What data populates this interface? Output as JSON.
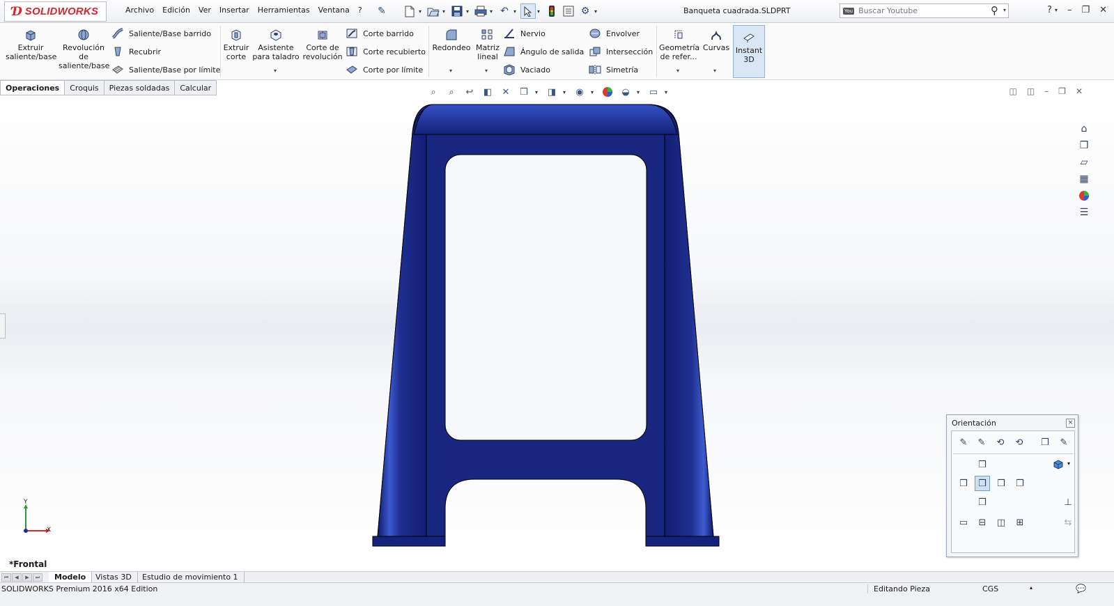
{
  "app": {
    "brand": "SOLIDWORKS",
    "document_title": "Banqueta cuadrada.SLDPRT"
  },
  "menu": [
    "Archivo",
    "Edición",
    "Ver",
    "Insertar",
    "Herramientas",
    "Ventana",
    "?"
  ],
  "search": {
    "placeholder": "Buscar Youtube",
    "badge": "You"
  },
  "ribbon": {
    "extruir_saliente": "Extruir\nsaliente/base",
    "revolucion_saliente": "Revolución\nde\nsaliente/base",
    "saliente_barrido": "Saliente/Base barrido",
    "recubrir": "Recubrir",
    "saliente_limite": "Saliente/Base por límite",
    "extruir_corte": "Extruir\ncorte",
    "asistente_taladro": "Asistente\npara taladro",
    "corte_revolucion": "Corte de\nrevolución",
    "corte_barrido": "Corte barrido",
    "corte_recubierto": "Corte recubierto",
    "corte_limite": "Corte por límite",
    "redondeo": "Redondeo",
    "matriz_lineal": "Matriz\nlineal",
    "nervio": "Nervio",
    "angulo_salida": "Ángulo de salida",
    "vaciado": "Vaciado",
    "envolver": "Envolver",
    "interseccion": "Intersección",
    "simetria": "Simetría",
    "geometria_referencia": "Geometría\nde refer...",
    "curvas": "Curvas",
    "instant3d": "Instant\n3D"
  },
  "command_tabs": [
    "Operaciones",
    "Croquis",
    "Piezas soldadas",
    "Calcular"
  ],
  "viewport": {
    "view_name": "*Frontal",
    "triad": {
      "x": "X",
      "y": "Y"
    },
    "part_color": "#1f2f8f"
  },
  "orientation_dialog": {
    "title": "Orientación",
    "close": "×"
  },
  "bottom_tabs": [
    "Modelo",
    "Vistas 3D",
    "Estudio de movimiento 1"
  ],
  "status": {
    "product": "SOLIDWORKS Premium 2016 x64 Edition",
    "mode": "Editando Pieza",
    "units": "CGS"
  }
}
